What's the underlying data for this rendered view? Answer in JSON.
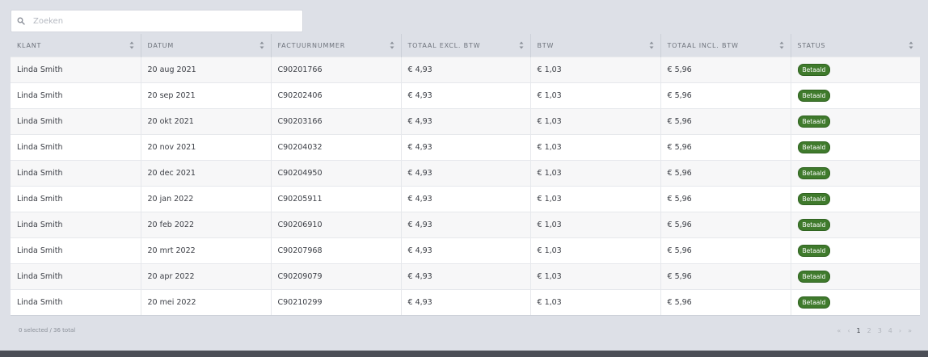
{
  "search": {
    "placeholder": "Zoeken"
  },
  "table": {
    "columns": [
      "KLANT",
      "DATUM",
      "FACTUURNUMMER",
      "TOTAAL EXCL. BTW",
      "BTW",
      "TOTAAL INCL. BTW",
      "STATUS"
    ],
    "rows": [
      [
        "Linda Smith",
        "20 aug 2021",
        "C90201766",
        "€ 4,93",
        "€ 1,03",
        "€ 5,96",
        "Betaald"
      ],
      [
        "Linda Smith",
        "20 sep 2021",
        "C90202406",
        "€ 4,93",
        "€ 1,03",
        "€ 5,96",
        "Betaald"
      ],
      [
        "Linda Smith",
        "20 okt 2021",
        "C90203166",
        "€ 4,93",
        "€ 1,03",
        "€ 5,96",
        "Betaald"
      ],
      [
        "Linda Smith",
        "20 nov 2021",
        "C90204032",
        "€ 4,93",
        "€ 1,03",
        "€ 5,96",
        "Betaald"
      ],
      [
        "Linda Smith",
        "20 dec 2021",
        "C90204950",
        "€ 4,93",
        "€ 1,03",
        "€ 5,96",
        "Betaald"
      ],
      [
        "Linda Smith",
        "20 jan 2022",
        "C90205911",
        "€ 4,93",
        "€ 1,03",
        "€ 5,96",
        "Betaald"
      ],
      [
        "Linda Smith",
        "20 feb 2022",
        "C90206910",
        "€ 4,93",
        "€ 1,03",
        "€ 5,96",
        "Betaald"
      ],
      [
        "Linda Smith",
        "20 mrt 2022",
        "C90207968",
        "€ 4,93",
        "€ 1,03",
        "€ 5,96",
        "Betaald"
      ],
      [
        "Linda Smith",
        "20 apr 2022",
        "C90209079",
        "€ 4,93",
        "€ 1,03",
        "€ 5,96",
        "Betaald"
      ],
      [
        "Linda Smith",
        "20 mei 2022",
        "C90210299",
        "€ 4,93",
        "€ 1,03",
        "€ 5,96",
        "Betaald"
      ]
    ]
  },
  "footer": {
    "selection_text": "0 selected / 36 total",
    "pagination": {
      "first": "«",
      "prev": "‹",
      "pages": [
        "1",
        "2",
        "3",
        "4"
      ],
      "current": "1",
      "next": "›",
      "last": "»"
    }
  },
  "colors": {
    "status_paid": "#3f7a2c",
    "background": "#dde0e7"
  },
  "icons": {
    "search": "search-icon",
    "sort": "sort-icon"
  }
}
